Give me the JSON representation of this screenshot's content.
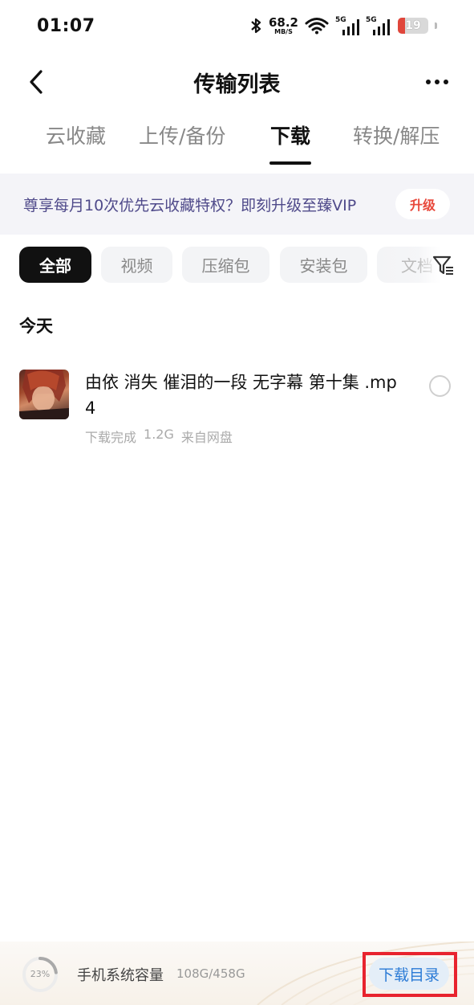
{
  "status_bar": {
    "time": "01:07",
    "net_speed": "68.2",
    "net_speed_unit": "MB/S",
    "signal1_label": "5G",
    "signal2_label": "5G",
    "battery": "19"
  },
  "header": {
    "title": "传输列表",
    "back_icon": "chevron-left-icon",
    "more_icon": "more-dots-icon"
  },
  "tabs": [
    {
      "label": "云收藏",
      "active": false
    },
    {
      "label": "上传/备份",
      "active": false
    },
    {
      "label": "下载",
      "active": true
    },
    {
      "label": "转换/解压",
      "active": false
    }
  ],
  "vip_banner": {
    "text": "尊享每月10次优先云收藏特权？即刻升级至臻VIP",
    "button": "升级",
    "text_color": "#4f4a8a",
    "button_color": "#e8483b"
  },
  "filters": [
    {
      "label": "全部",
      "active": true
    },
    {
      "label": "视频",
      "active": false
    },
    {
      "label": "压缩包",
      "active": false
    },
    {
      "label": "安装包",
      "active": false
    },
    {
      "label": "文档",
      "active": false
    }
  ],
  "section": {
    "title": "今天"
  },
  "files": [
    {
      "name": "由依 消失 催泪的一段 无字幕 第十集 .mp4",
      "status": "下载完成",
      "size": "1.2G",
      "source": "来自网盘"
    }
  ],
  "bottom_bar": {
    "storage_percent_label": "23%",
    "storage_fraction": 0.23,
    "storage_label": "手机系统容量",
    "storage_value": "108G/458G",
    "download_dir_button": "下载目录",
    "accent_color": "#2b7bd6"
  }
}
